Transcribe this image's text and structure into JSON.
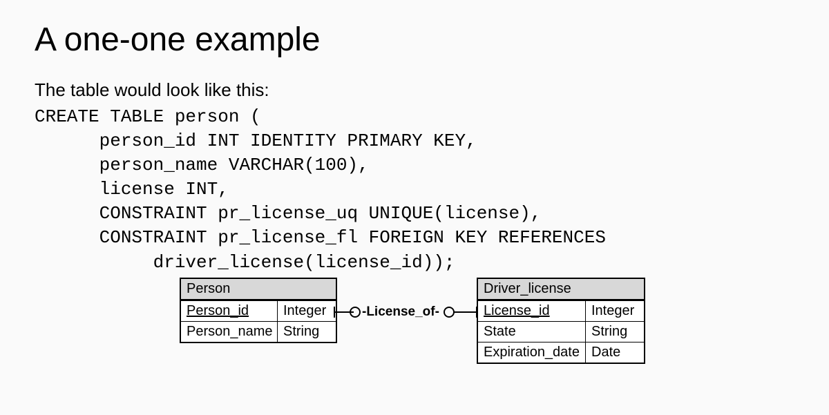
{
  "title": "A one-one example",
  "subtitle": "The table would look like this:",
  "sql_lines": [
    "CREATE TABLE person (",
    "      person_id INT IDENTITY PRIMARY KEY,",
    "      person_name VARCHAR(100),",
    "      license INT,",
    "      CONSTRAINT pr_license_uq UNIQUE(license),",
    "      CONSTRAINT pr_license_fl FOREIGN KEY REFERENCES",
    "           driver_license(license_id));"
  ],
  "close": ");",
  "entity_person": {
    "name": "Person",
    "rows": [
      {
        "attr": "Person_id",
        "type": "Integer",
        "key": true
      },
      {
        "attr": "Person_name",
        "type": "String",
        "key": false
      }
    ]
  },
  "entity_driver": {
    "name": "Driver_license",
    "rows": [
      {
        "attr": "License_id",
        "type": "Integer",
        "key": true
      },
      {
        "attr": "State",
        "type": "String",
        "key": false
      },
      {
        "attr": "Expiration_date",
        "type": "Date",
        "key": false
      }
    ]
  },
  "relationship_label": "-License_of-"
}
